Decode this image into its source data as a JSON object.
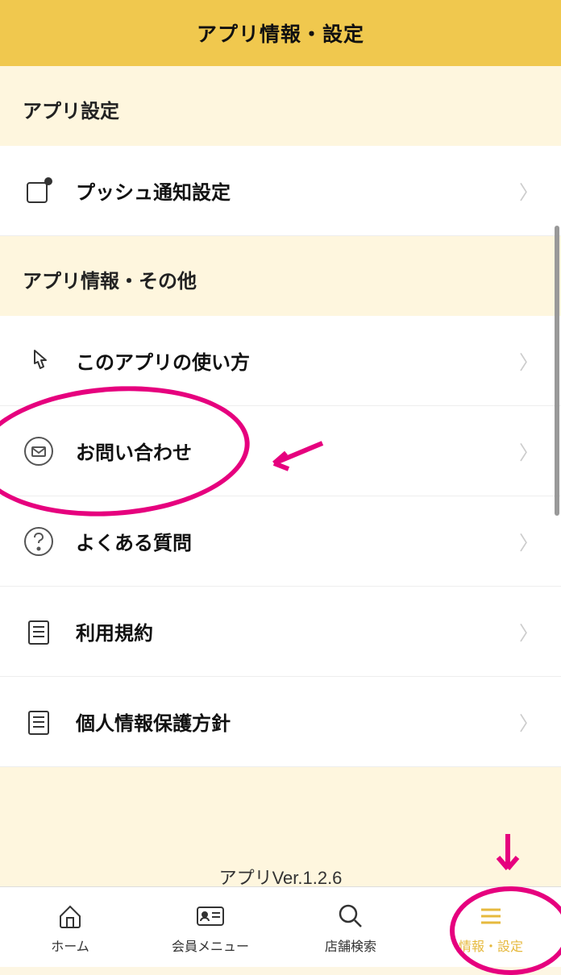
{
  "header": {
    "title": "アプリ情報・設定"
  },
  "sections": {
    "settings": {
      "title": "アプリ設定"
    },
    "info": {
      "title": "アプリ情報・その他"
    }
  },
  "items": {
    "push": "プッシュ通知設定",
    "usage": "このアプリの使い方",
    "contact": "お問い合わせ",
    "faq": "よくある質問",
    "terms": "利用規約",
    "privacy": "個人情報保護方針"
  },
  "version": "アプリVer.1.2.6",
  "nav": {
    "home": "ホーム",
    "member": "会員メニュー",
    "search": "店舗検索",
    "settings": "情報・設定"
  }
}
